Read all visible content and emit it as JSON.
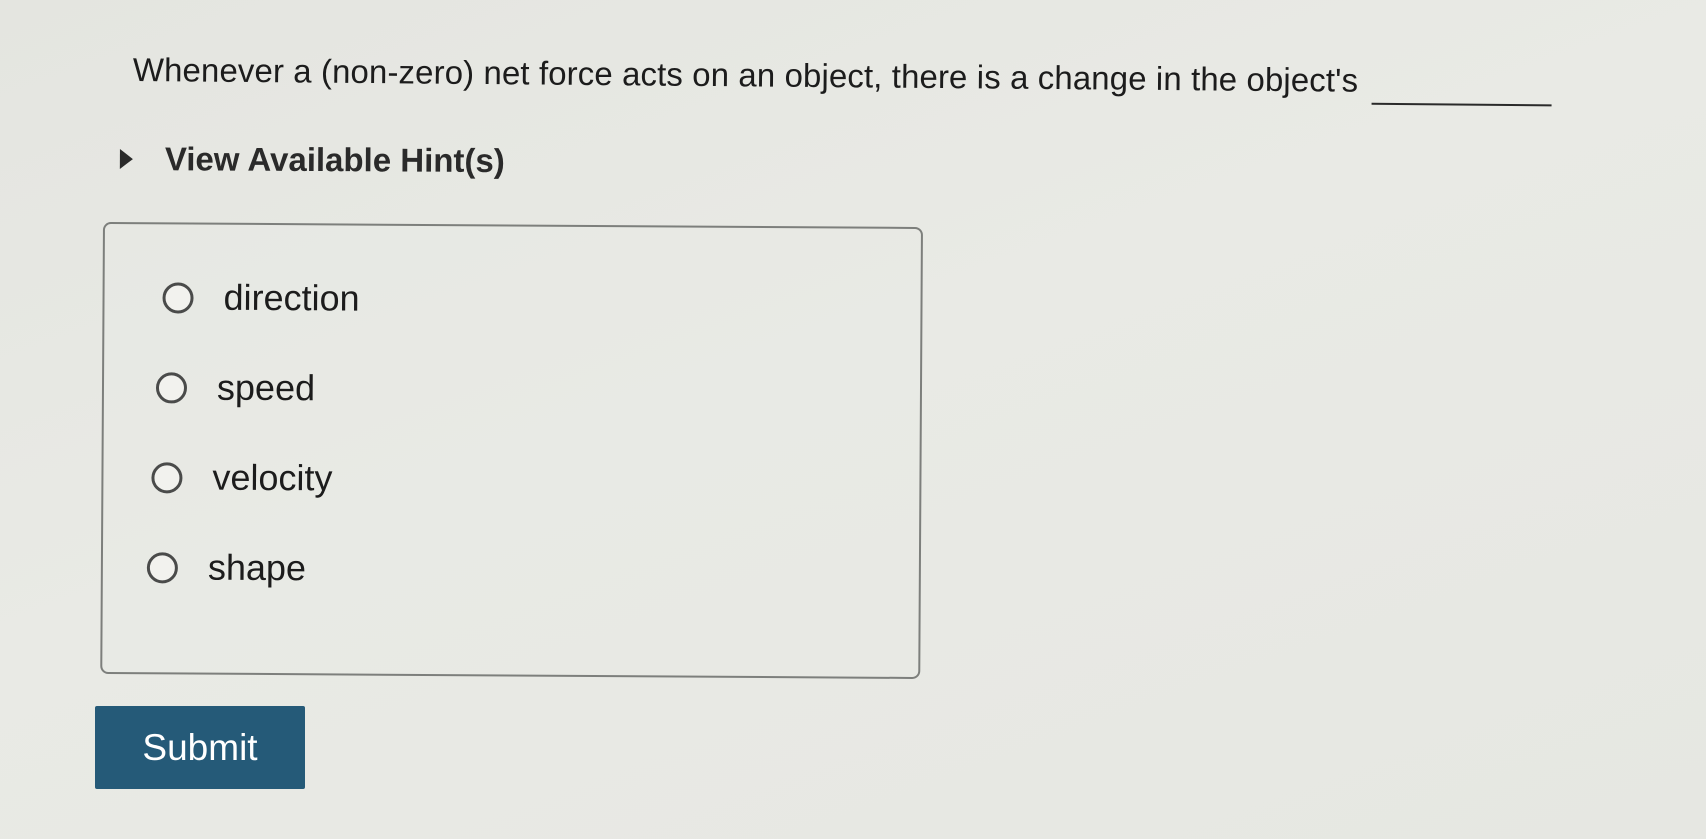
{
  "question": {
    "text": "Whenever a (non-zero) net force acts on an object, there is a change in the object's"
  },
  "hints": {
    "label": "View Available Hint(s)"
  },
  "options": [
    {
      "label": "direction"
    },
    {
      "label": "speed"
    },
    {
      "label": "velocity"
    },
    {
      "label": "shape"
    }
  ],
  "submit": {
    "label": "Submit",
    "color": "#255a78"
  },
  "colors": {
    "background": "#e6e7e2",
    "text": "#1c1c1c"
  }
}
